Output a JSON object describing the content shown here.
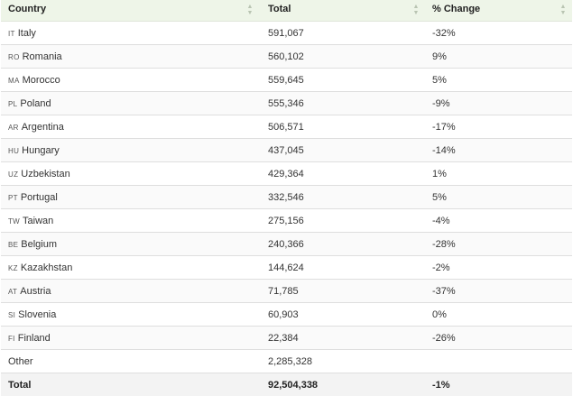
{
  "table": {
    "columns": [
      {
        "label": "Country",
        "sort_icon": "sort-icon"
      },
      {
        "label": "Total",
        "sort_icon": "sort-icon"
      },
      {
        "label": "% Change",
        "sort_icon": "sort-icon"
      }
    ],
    "rows": [
      {
        "code": "IT",
        "country": "Italy",
        "total": "591,067",
        "change": "-32%"
      },
      {
        "code": "RO",
        "country": "Romania",
        "total": "560,102",
        "change": "9%"
      },
      {
        "code": "MA",
        "country": "Morocco",
        "total": "559,645",
        "change": "5%"
      },
      {
        "code": "PL",
        "country": "Poland",
        "total": "555,346",
        "change": "-9%"
      },
      {
        "code": "AR",
        "country": "Argentina",
        "total": "506,571",
        "change": "-17%"
      },
      {
        "code": "HU",
        "country": "Hungary",
        "total": "437,045",
        "change": "-14%"
      },
      {
        "code": "UZ",
        "country": "Uzbekistan",
        "total": "429,364",
        "change": "1%"
      },
      {
        "code": "PT",
        "country": "Portugal",
        "total": "332,546",
        "change": "5%"
      },
      {
        "code": "TW",
        "country": "Taiwan",
        "total": "275,156",
        "change": "-4%"
      },
      {
        "code": "BE",
        "country": "Belgium",
        "total": "240,366",
        "change": "-28%"
      },
      {
        "code": "KZ",
        "country": "Kazakhstan",
        "total": "144,624",
        "change": "-2%"
      },
      {
        "code": "AT",
        "country": "Austria",
        "total": "71,785",
        "change": "-37%"
      },
      {
        "code": "SI",
        "country": "Slovenia",
        "total": "60,903",
        "change": "0%"
      },
      {
        "code": "FI",
        "country": "Finland",
        "total": "22,384",
        "change": "-26%"
      },
      {
        "code": "",
        "country": "Other",
        "total": "2,285,328",
        "change": ""
      }
    ],
    "footer": {
      "label": "Total",
      "total": "92,504,338",
      "change": "-1%"
    }
  },
  "colors": {
    "header_bg": "#eef5e8",
    "row_border": "#dedede",
    "footer_bg": "#f3f3f3"
  }
}
